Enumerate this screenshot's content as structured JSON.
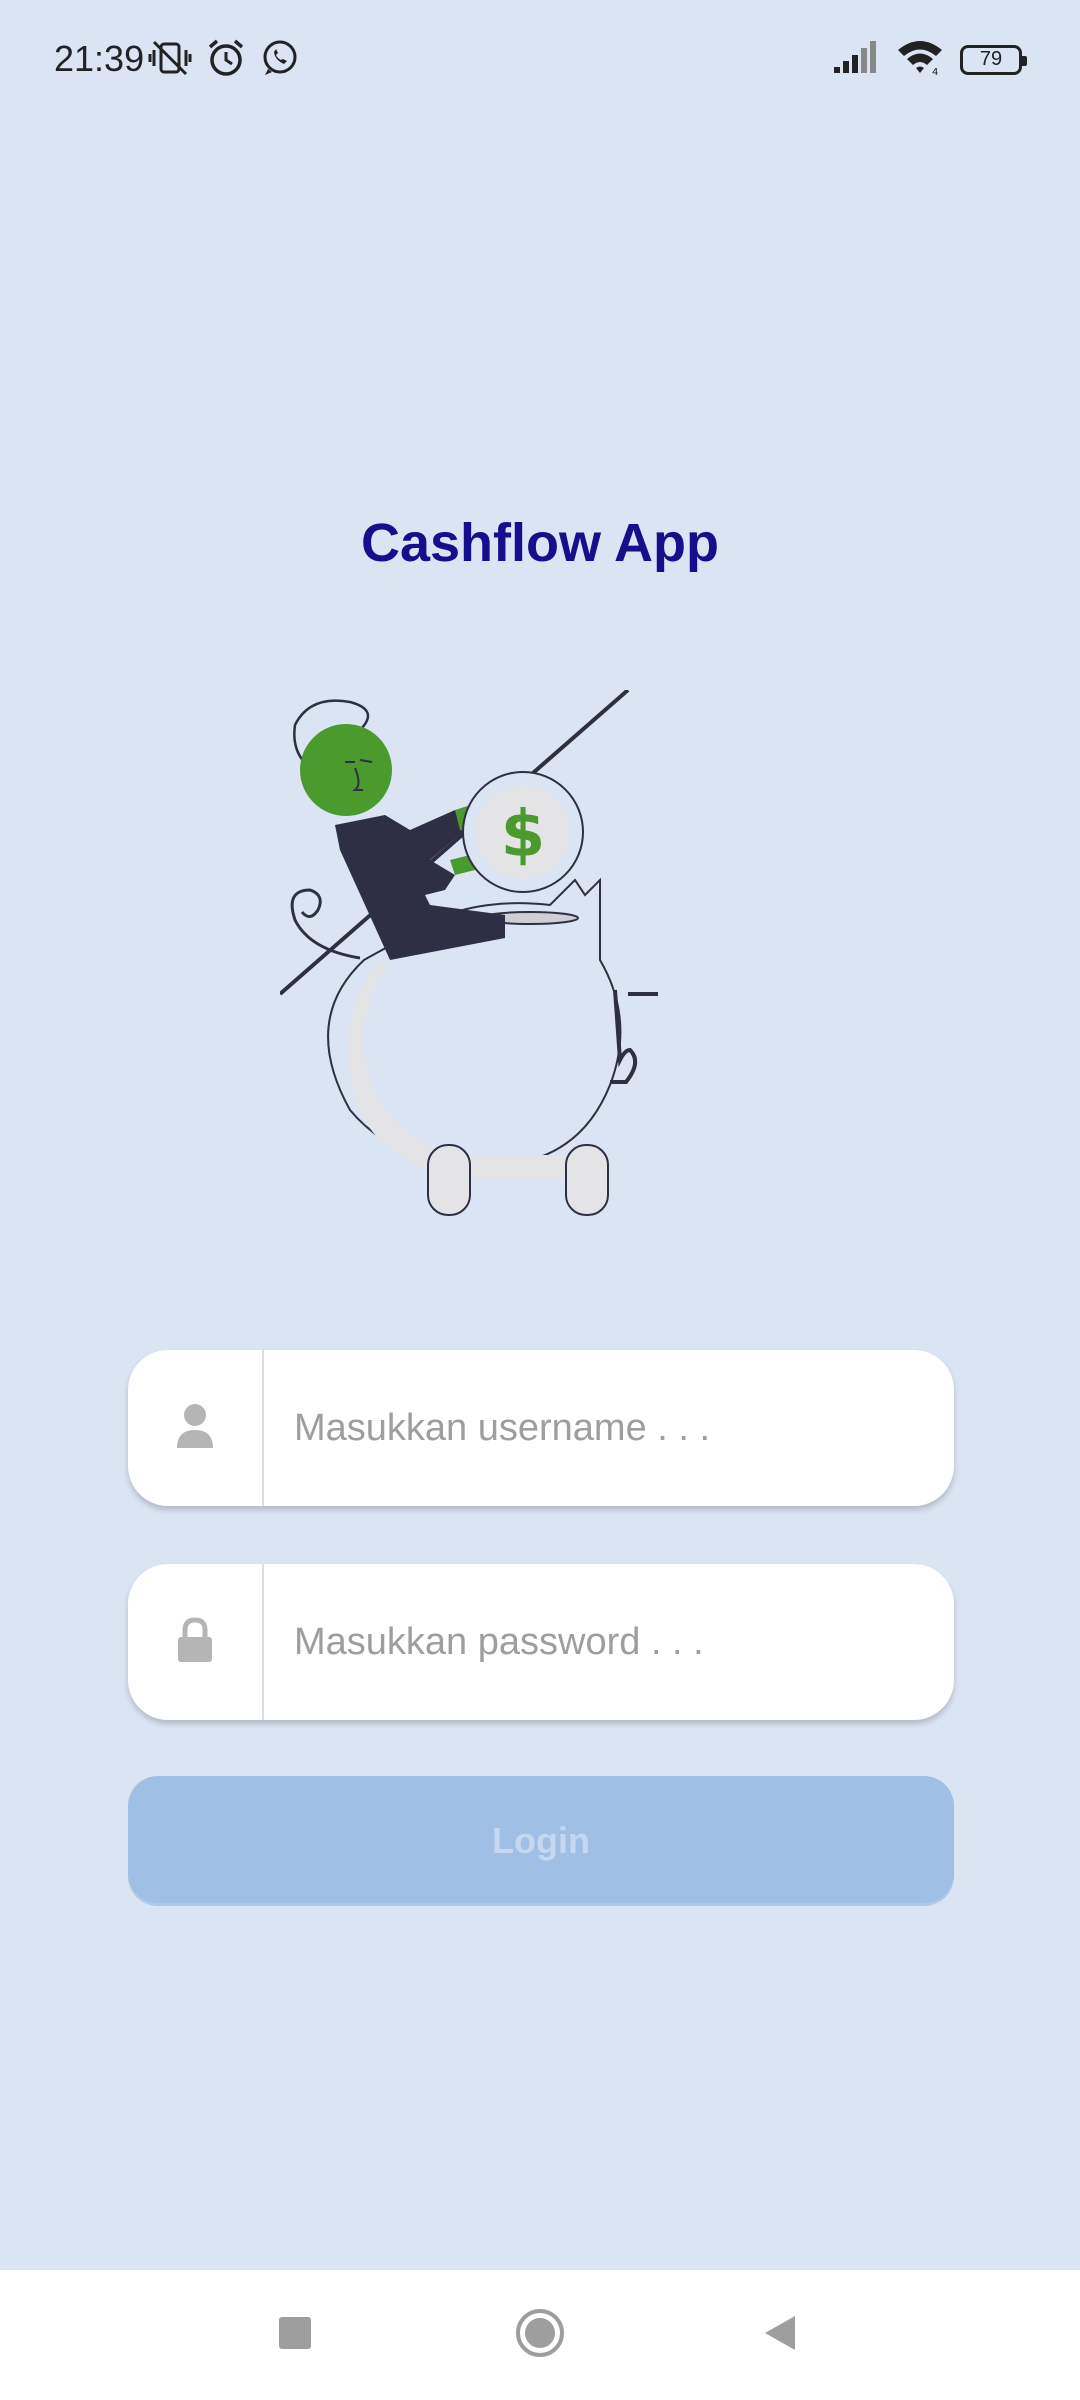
{
  "status_bar": {
    "time": "21:39",
    "battery_level": "79",
    "left_icons": [
      "vibrate-off-icon",
      "alarm-icon",
      "whatsapp-icon"
    ],
    "right_icons": [
      "signal-icon",
      "wifi-icon",
      "battery-icon"
    ]
  },
  "app": {
    "title": "Cashflow App",
    "title_color": "#140f8c"
  },
  "login_form": {
    "username": {
      "value": "",
      "placeholder": "Masukkan username . . .",
      "icon": "user-icon"
    },
    "password": {
      "value": "",
      "placeholder": "Masukkan password . . .",
      "icon": "lock-icon"
    },
    "login_label": "Login",
    "login_button_color": "#a0bfe4"
  },
  "illustration": {
    "coin_symbol": "$",
    "accent_color": "#4a9a2e"
  },
  "nav_bar": {
    "buttons": [
      "recents-icon",
      "home-icon",
      "back-icon"
    ]
  }
}
